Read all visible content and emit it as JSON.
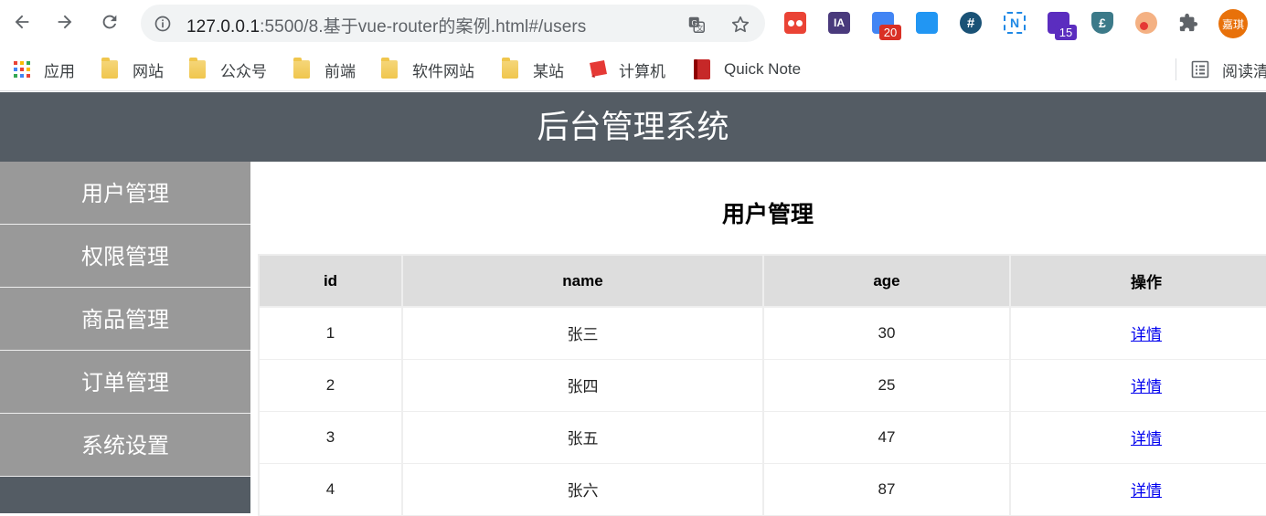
{
  "browser": {
    "url_host": "127.0.0.1",
    "url_path": ":5500/8.基于vue-router的案例.html#/users",
    "extensions": [
      {
        "name": "readit-extension",
        "text": "",
        "color": "#ea4335",
        "badge": ""
      },
      {
        "name": "ia-extension",
        "text": "IA",
        "color": "#4a3a7c",
        "badge": ""
      },
      {
        "name": "rss-extension",
        "text": "",
        "color": "#4285f4",
        "badge": "20",
        "badge_color": "#d93025"
      },
      {
        "name": "blue-square-extension",
        "text": "",
        "color": "#2196f3",
        "badge": ""
      },
      {
        "name": "hashtag-extension",
        "text": "#",
        "color": "#1a5276",
        "badge": ""
      },
      {
        "name": "n-extension",
        "text": "N",
        "color": "#ffffff",
        "badge": ""
      },
      {
        "name": "graduation-extension",
        "text": "",
        "color": "#5b2dbf",
        "badge": "15",
        "badge_color": "#5b2dbf"
      },
      {
        "name": "shield-extension",
        "text": "£",
        "color": "#3c7a89",
        "badge": ""
      },
      {
        "name": "rss-orange-extension",
        "text": "",
        "color": "#f4b183",
        "badge": ""
      }
    ],
    "avatar_text": "嘉琪"
  },
  "bookmarks": {
    "items": [
      {
        "label": "应用",
        "type": "apps"
      },
      {
        "label": "网站",
        "type": "folder"
      },
      {
        "label": "公众号",
        "type": "folder"
      },
      {
        "label": "前端",
        "type": "folder"
      },
      {
        "label": "软件网站",
        "type": "folder"
      },
      {
        "label": "某站",
        "type": "folder"
      },
      {
        "label": "计算机",
        "type": "red"
      },
      {
        "label": "Quick Note",
        "type": "book"
      }
    ],
    "reading_list": "阅读清"
  },
  "app": {
    "title": "后台管理系统",
    "sidebar": [
      {
        "label": "用户管理"
      },
      {
        "label": "权限管理"
      },
      {
        "label": "商品管理"
      },
      {
        "label": "订单管理"
      },
      {
        "label": "系统设置"
      }
    ],
    "main_title": "用户管理",
    "table": {
      "headers": [
        "id",
        "name",
        "age",
        "操作"
      ],
      "rows": [
        {
          "id": "1",
          "name": "张三",
          "age": "30",
          "action": "详情"
        },
        {
          "id": "2",
          "name": "张四",
          "age": "25",
          "action": "详情"
        },
        {
          "id": "3",
          "name": "张五",
          "age": "47",
          "action": "详情"
        },
        {
          "id": "4",
          "name": "张六",
          "age": "87",
          "action": "详情"
        }
      ]
    }
  }
}
